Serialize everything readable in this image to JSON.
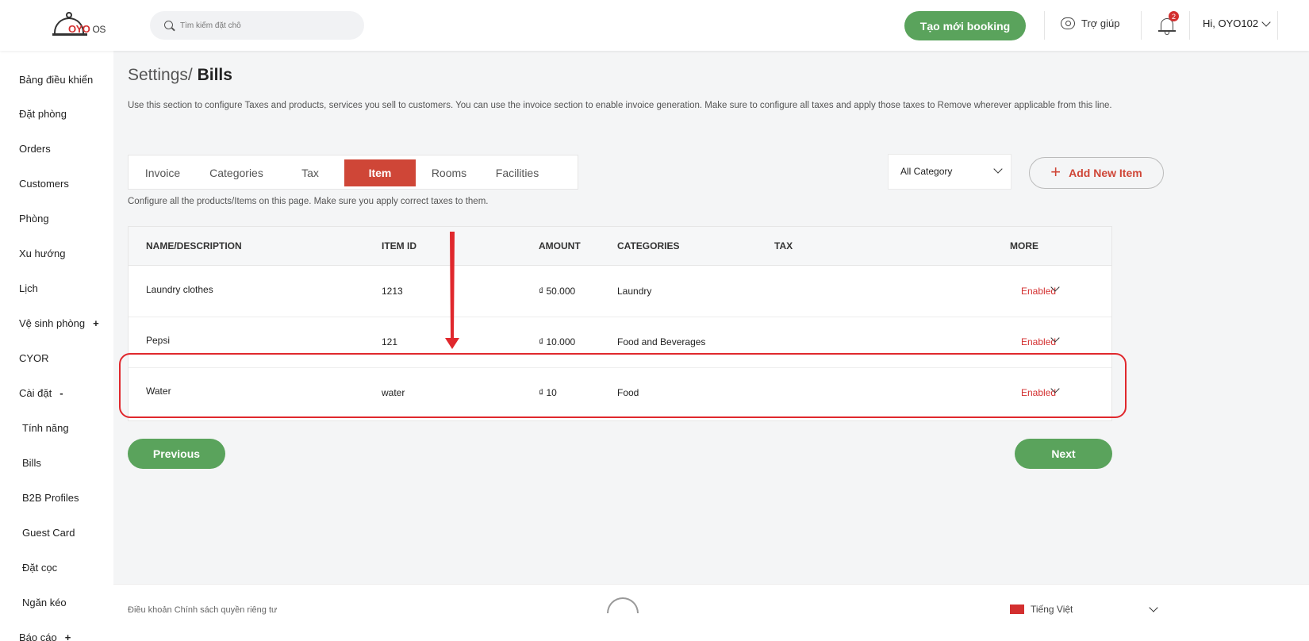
{
  "header": {
    "logo_text": "OYO",
    "logo_suffix": "OS",
    "search_placeholder": "Tìm kiếm đặt chỗ",
    "create_booking": "Tạo mới booking",
    "help": "Trợ giúp",
    "notification_count": "2",
    "user_greeting": "Hi, OYO102"
  },
  "sidebar": {
    "items": [
      {
        "label": "Bảng điều khiển"
      },
      {
        "label": "Đặt phòng"
      },
      {
        "label": "Orders"
      },
      {
        "label": "Customers"
      },
      {
        "label": "Phòng"
      },
      {
        "label": "Xu hướng"
      },
      {
        "label": "Lịch"
      },
      {
        "label": "Vệ sinh phòng",
        "sign": "+"
      },
      {
        "label": "CYOR"
      },
      {
        "label": "Cài đặt",
        "sign": "-"
      },
      {
        "label": "Tính năng"
      },
      {
        "label": "Bills"
      },
      {
        "label": "B2B Profiles"
      },
      {
        "label": "Guest Card"
      },
      {
        "label": "Đặt cọc"
      },
      {
        "label": "Ngăn kéo"
      },
      {
        "label": "Báo cáo",
        "sign": "+"
      }
    ]
  },
  "page": {
    "breadcrumb_parent": "Settings/",
    "breadcrumb_current": "Bills",
    "description": "Use this section to configure Taxes and products, services you sell to customers. You can use the invoice section to enable invoice generation. Make sure to configure all taxes and apply those taxes to Remove wherever applicable from this line.",
    "tabs": [
      "Invoice",
      "Categories",
      "Tax",
      "Item",
      "Rooms",
      "Facilities"
    ],
    "active_tab": "Item",
    "category_filter": "All Category",
    "add_button": "Add New Item",
    "sub_description": "Configure all the products/Items on this page. Make sure you apply correct taxes to them."
  },
  "table": {
    "headers": [
      "NAME/DESCRIPTION",
      "ITEM ID",
      "AMOUNT",
      "CATEGORIES",
      "TAX",
      "MORE"
    ],
    "rows": [
      {
        "name": "Laundry clothes",
        "id": "1213",
        "amount": "₫ 50.000",
        "category": "Laundry",
        "tax": "",
        "status": "Enabled"
      },
      {
        "name": "Pepsi",
        "id": "121",
        "amount": "₫ 10.000",
        "category": "Food and Beverages",
        "tax": "",
        "status": "Enabled"
      },
      {
        "name": "Water",
        "id": "water",
        "amount": "₫ 10",
        "category": "Food",
        "tax": "",
        "status": "Enabled"
      }
    ]
  },
  "pagination": {
    "previous": "Previous",
    "next": "Next"
  },
  "footer": {
    "links": "Điều khoản   Chính sách quyền riêng tư",
    "language": "Tiếng Việt"
  },
  "colors": {
    "accent_green": "#5aa35c",
    "accent_red": "#cf4637",
    "annotation_red": "#e0282d"
  }
}
